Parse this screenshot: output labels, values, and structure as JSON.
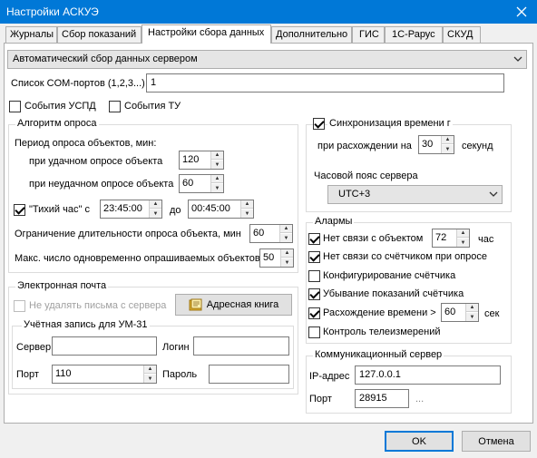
{
  "window": {
    "title": "Настройки АСКУЭ"
  },
  "tabs": [
    {
      "label": "Журналы"
    },
    {
      "label": "Сбор показаний"
    },
    {
      "label": "Настройки сбора данных"
    },
    {
      "label": "Дополнительно"
    },
    {
      "label": "ГИС"
    },
    {
      "label": "1С-Рарус"
    },
    {
      "label": "СКУД"
    }
  ],
  "mode_select": {
    "value": "Автоматический сбор данных сервером"
  },
  "com_ports": {
    "label": "Список COM-портов (1,2,3...)",
    "value": "1"
  },
  "events": {
    "uspd_label": "События УСПД",
    "uspd_checked": false,
    "tu_label": "События ТУ",
    "tu_checked": false
  },
  "poll": {
    "group_label": "Алгоритм опроса",
    "period_label": "Период опроса объектов, мин:",
    "success_label": "при удачном опросе объекта",
    "success_value": "120",
    "fail_label": "при неудачном опросе объекта",
    "fail_value": "60",
    "quiet_label": "\"Тихий час\" с",
    "quiet_checked": true,
    "quiet_from": "23:45:00",
    "quiet_to_label": "до",
    "quiet_to": "00:45:00",
    "limit_label": "Ограничение длительности опроса объекта, мин",
    "limit_value": "60",
    "max_label": "Макс. число одновременно опрашиваемых объектов",
    "max_value": "50"
  },
  "email": {
    "group_label": "Электронная почта",
    "keep_label": "Не удалять письма с сервера",
    "keep_checked": false,
    "addressbook_label": "Адресная книга",
    "account_label": "Учётная запись для УМ-31",
    "server_label": "Сервер",
    "server_value": "",
    "login_label": "Логин",
    "login_value": "",
    "port_label": "Порт",
    "port_value": "110",
    "password_label": "Пароль",
    "password_value": ""
  },
  "time_sync": {
    "checkbox_label": "Синхронизация времени г",
    "checked": true,
    "diff_label": "при расхождении на",
    "diff_value": "30",
    "unit_label": "секунд",
    "tz_label": "Часовой пояс сервера",
    "tz_value": "UTC+3"
  },
  "alarms": {
    "group_label": "Алармы",
    "items": [
      {
        "label": "Нет связи с объектом",
        "checked": true,
        "value": "72",
        "unit": "час"
      },
      {
        "label": "Нет связи со счётчиком при опросе",
        "checked": true
      },
      {
        "label": "Конфигурирование счётчика",
        "checked": false
      },
      {
        "label": "Убывание показаний счётчика",
        "checked": true
      },
      {
        "label": "Расхождение времени >",
        "checked": true,
        "value": "60",
        "unit": "сек"
      },
      {
        "label": "Контроль телеизмерений",
        "checked": false
      }
    ]
  },
  "comm_server": {
    "group_label": "Коммуникационный сервер",
    "ip_label": "IP-адрес",
    "ip_value": "127.0.0.1",
    "port_label": "Порт",
    "port_value": "28915",
    "more_label": "..."
  },
  "footer": {
    "ok_label": "OK",
    "cancel_label": "Отмена"
  }
}
